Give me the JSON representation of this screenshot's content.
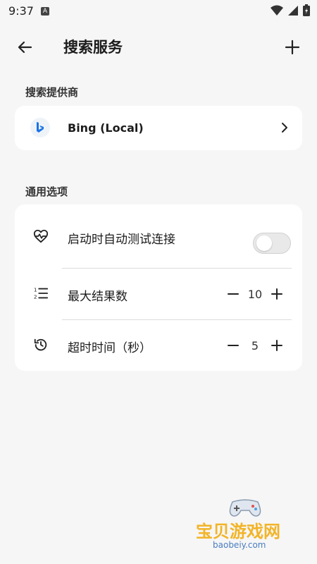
{
  "status": {
    "time": "9:37",
    "notification_letter": "A"
  },
  "header": {
    "title": "搜索服务"
  },
  "providers": {
    "section_label": "搜索提供商",
    "items": [
      {
        "label": "Bing (Local)",
        "icon": "bing-icon"
      }
    ]
  },
  "options": {
    "section_label": "通用选项",
    "auto_test": {
      "label": "启动时自动测试连接",
      "enabled": false
    },
    "max_results": {
      "label": "最大结果数",
      "value": "10"
    },
    "timeout": {
      "label": "超时时间（秒）",
      "value": "5"
    }
  },
  "watermark": {
    "text": "宝贝游戏网",
    "url": "baobeiy.com"
  },
  "colors": {
    "background": "#f6f6f6",
    "card": "#ffffff",
    "accent": "#1a73e8"
  }
}
